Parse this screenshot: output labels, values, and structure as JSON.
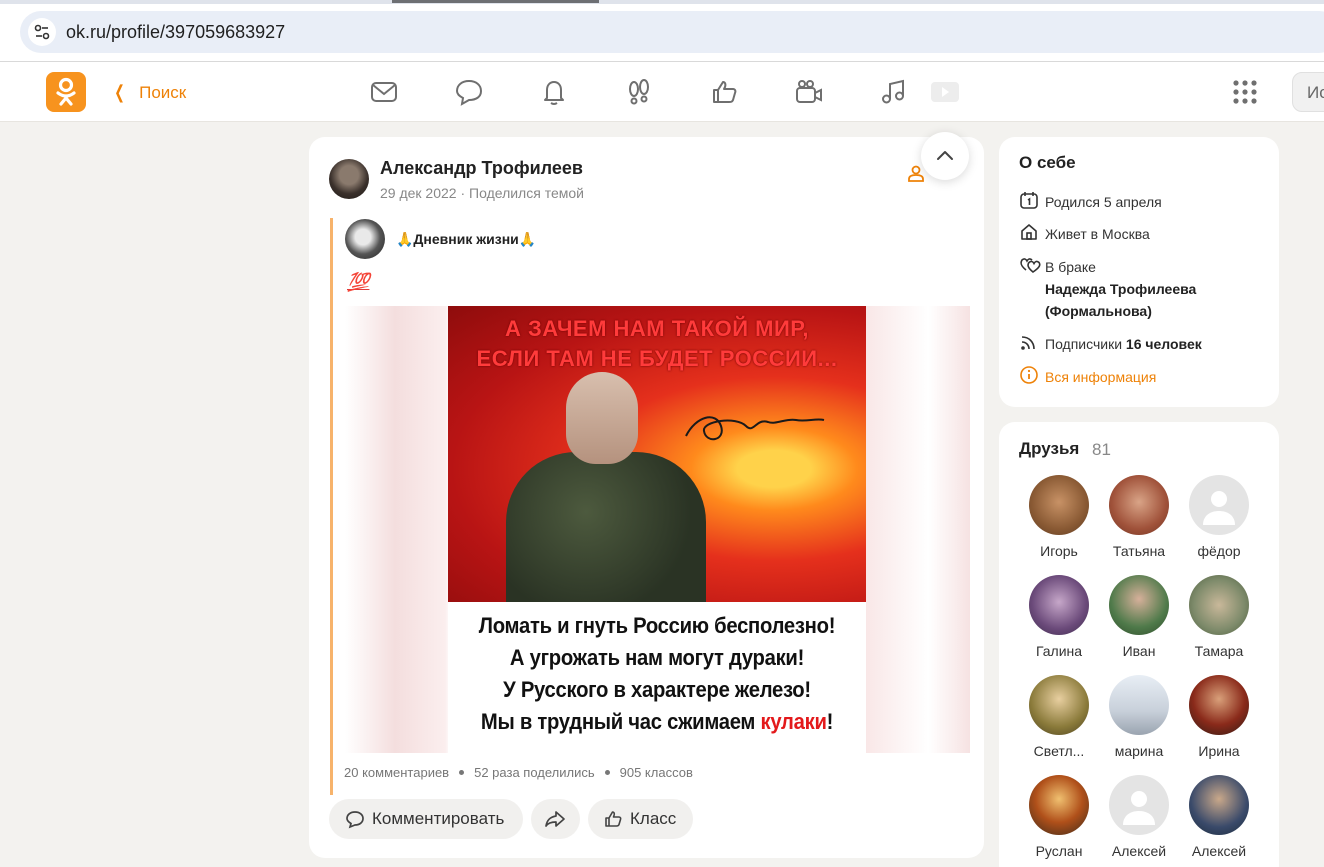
{
  "browser": {
    "url": "ok.ru/profile/397059683927"
  },
  "header": {
    "back_label": "Поиск",
    "search_placeholder": "Ис",
    "accent_color": "#ee8208",
    "nav_icons": [
      "envelope-icon",
      "chat-bubble-icon",
      "bell-icon",
      "guests-footprints-icon",
      "like-icon",
      "video-camera-icon",
      "music-note-icon",
      "video-play-icon"
    ]
  },
  "post": {
    "author": "Александр Трофилеев",
    "date": "29 дек 2022",
    "meta_separator": "·",
    "action": "Поделился темой",
    "group_name": "🙏Дневник жизни🙏",
    "emoji": "💯",
    "image": {
      "headline_1": "А ЗАЧЕМ НАМ ТАКОЙ МИР,",
      "headline_2": "ЕСЛИ ТАМ НЕ БУДЕТ РОССИИ...",
      "line_1": "Ломать и гнуть Россию бесполезно!",
      "line_2": "А угрожать нам могут дураки!",
      "line_3": "У Русского в характере железо!",
      "line_4_main": "Мы в трудный час сжимаем ",
      "line_4_red": "кулаки",
      "line_4_end": "!"
    },
    "stats": {
      "comments": "20 комментариев",
      "shares": "52 раза поделились",
      "likes": "905 классов"
    },
    "buttons": {
      "comment": "Комментировать",
      "like": "Класс"
    }
  },
  "about": {
    "title": "О себе",
    "born": "Родился 5 апреля",
    "lives": "Живет в Москва",
    "marital": "В браке",
    "spouse_1": "Надежда Трофилеева",
    "spouse_2": "(Формальнова)",
    "subscribers_label": "Подписчики ",
    "subscribers_value": "16 человек",
    "all_info": "Вся информация"
  },
  "friends": {
    "title": "Друзья",
    "count": "81",
    "items": [
      {
        "name": "Игорь"
      },
      {
        "name": "Татьяна"
      },
      {
        "name": "фёдор"
      },
      {
        "name": "Галина"
      },
      {
        "name": "Иван"
      },
      {
        "name": "Тамара"
      },
      {
        "name": "Светл..."
      },
      {
        "name": "марина"
      },
      {
        "name": "Ирина"
      },
      {
        "name": "Руслан"
      },
      {
        "name": "Алексей"
      },
      {
        "name": "Алексей"
      }
    ]
  }
}
